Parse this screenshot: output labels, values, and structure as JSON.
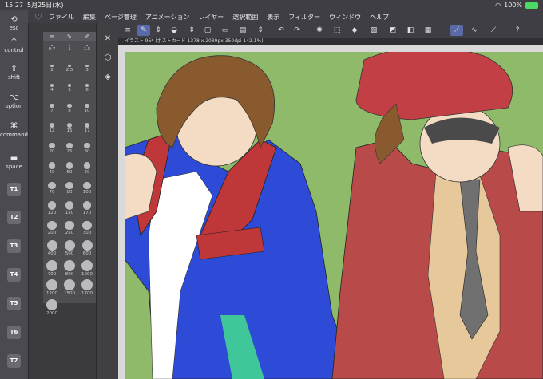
{
  "status": {
    "time": "15:27",
    "date": "5月25日(水)",
    "battery": "100%"
  },
  "menu": {
    "items": [
      "ファイル",
      "編集",
      "ページ管理",
      "アニメーション",
      "レイヤー",
      "選択範囲",
      "表示",
      "フィルター",
      "ウィンドウ",
      "ヘルプ"
    ]
  },
  "keys": {
    "esc": "esc",
    "control": "control",
    "shift": "shift",
    "option": "option",
    "command": "command",
    "space": "space",
    "t": [
      "T1",
      "T2",
      "T3",
      "T4",
      "T5",
      "T6",
      "T7"
    ]
  },
  "document": {
    "tab": "イラスト 95* (ポストカード 1378 x 2039px 350dpi 142.1%)"
  },
  "brushes": {
    "sizes": [
      "0.7",
      "1",
      "1.5",
      "2",
      "2.5",
      "3",
      "4",
      "5",
      "6",
      "7",
      "8",
      "10",
      "12",
      "15",
      "17",
      "20",
      "25",
      "30",
      "40",
      "50",
      "60",
      "70",
      "80",
      "100",
      "120",
      "150",
      "170",
      "200",
      "250",
      "300",
      "400",
      "500",
      "600",
      "700",
      "800",
      "1000",
      "1200",
      "1500",
      "1700",
      "2000"
    ]
  },
  "colors": {
    "canvas_bg": "#8eba6a",
    "jacket_blue": "#2e4bd8",
    "jacket_red": "#c0373a",
    "coat_red": "#b84a4a",
    "skin": "#f4dcc4",
    "hair": "#8a5a2f",
    "accent": "#5a6aa8"
  },
  "icons": [
    "undo-icon",
    "redo-icon",
    "layer-icon",
    "pen-tool-icon",
    "eraser-icon",
    "selection-icon",
    "fill-icon",
    "help-icon"
  ]
}
